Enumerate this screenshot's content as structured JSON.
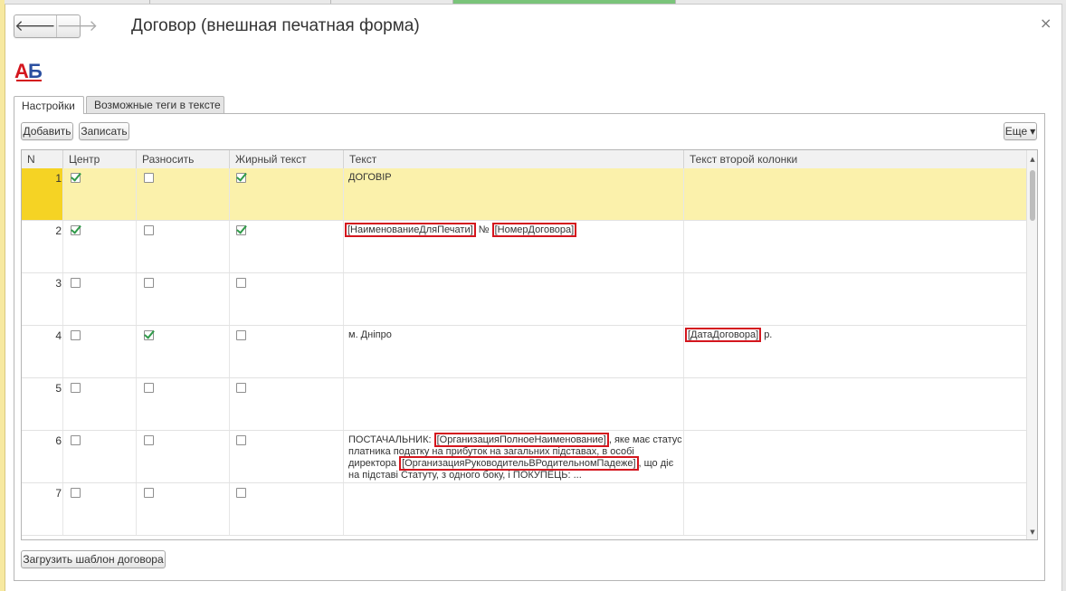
{
  "window": {
    "title": "Договор (внешная печатная форма)",
    "back_icon": "arrow-left-icon",
    "forward_icon": "arrow-right-icon",
    "close_glyph": "×"
  },
  "logo": {
    "text": "АБ",
    "color_a": "#d4161e",
    "color_b": "#2a4fa0"
  },
  "tabs": [
    {
      "label": "Настройки",
      "active": true
    },
    {
      "label": "Возможные теги в тексте",
      "active": false
    }
  ],
  "toolbar": {
    "add_label": "Добавить",
    "save_label": "Записать",
    "more_label": "Еще"
  },
  "grid": {
    "columns": [
      "N",
      "Центр",
      "Разносить",
      "Жирный текст",
      "Текст",
      "Текст второй колонки"
    ],
    "rows": [
      {
        "n": "1",
        "center": true,
        "spread": false,
        "bold": true,
        "text": "ДОГОВІР",
        "text2": ""
      },
      {
        "n": "2",
        "center": true,
        "spread": false,
        "bold": true,
        "text": "[НаименованиеДляПечати] № [НомерДоговора]",
        "text2": ""
      },
      {
        "n": "3",
        "center": false,
        "spread": false,
        "bold": false,
        "text": "",
        "text2": ""
      },
      {
        "n": "4",
        "center": false,
        "spread": true,
        "bold": false,
        "text": "м. Дніпро",
        "text2": "[ДатаДоговора] р."
      },
      {
        "n": "5",
        "center": false,
        "spread": false,
        "bold": false,
        "text": "",
        "text2": ""
      },
      {
        "n": "6",
        "center": false,
        "spread": false,
        "bold": false,
        "text": "ПОСТАЧАЛЬНИК: [ОрганизацияПолноеНаименование], яке має статус платника податку на прибуток на загальних підставах, в особі директора [ОрганизацияРуководительВРодительномПадеже], що діє на підставі Статуту, з одного боку, і ПОКУПЕЦЬ: ...",
        "text2": ""
      },
      {
        "n": "7",
        "center": false,
        "spread": false,
        "bold": false,
        "text": "",
        "text2": ""
      }
    ],
    "tags": {
      "name_for_print": "[НаименованиеДляПечати]",
      "contract_number": "[НомерДоговора]",
      "contract_date": "[ДатаДоговора]",
      "org_full_name": "[ОрганизацияПолноеНаименование]",
      "org_director": "[ОрганизацияРуководительВРодительномПадеже]"
    },
    "row2_sep": "№",
    "row4_suffix": "р.",
    "row6_p1": "ПОСТАЧАЛЬНИК: ",
    "row6_p2": ", яке має статус платника податку на прибуток на загальних підставах, в особі директора ",
    "row6_p3": ", що діє на підставі Статуту, з одного боку, і ПОКУПЕЦЬ: ..."
  },
  "footer": {
    "load_template_label": "Загрузить шаблон договора"
  },
  "colors": {
    "selected_row": "#fbf1ab",
    "row_marker": "#f5d324",
    "tag_border": "#d4161e",
    "check": "#2f9a49"
  }
}
